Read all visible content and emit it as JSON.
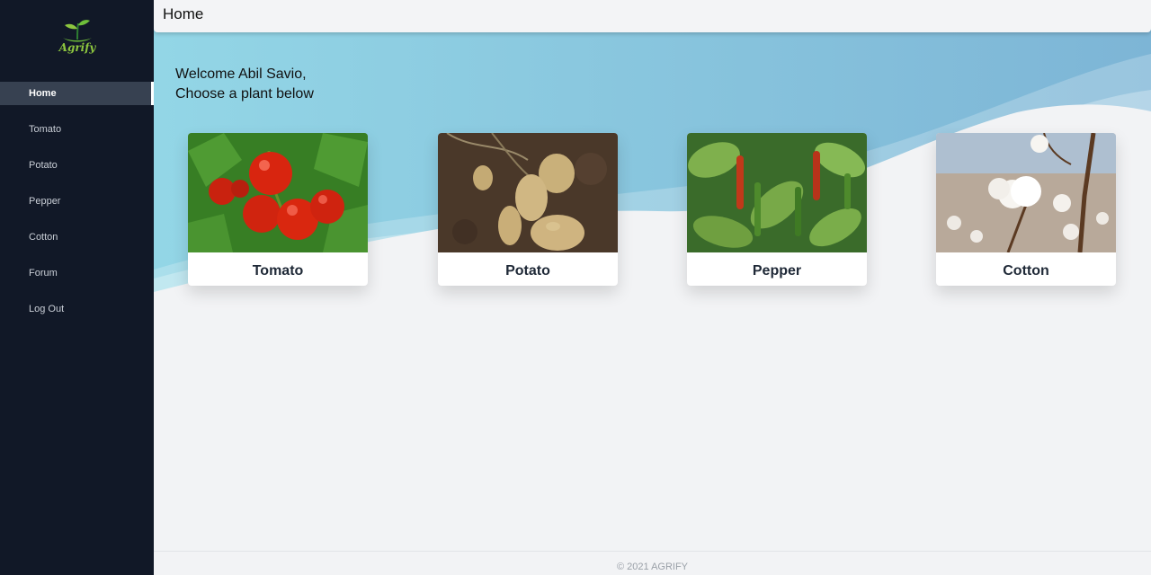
{
  "brand": {
    "name": "Agrify",
    "color": "#8dc63f"
  },
  "sidebar": {
    "items": [
      {
        "label": "Home",
        "active": true
      },
      {
        "label": "Tomato"
      },
      {
        "label": "Potato"
      },
      {
        "label": "Pepper"
      },
      {
        "label": "Cotton"
      },
      {
        "label": "Forum"
      },
      {
        "label": "Log Out"
      }
    ]
  },
  "header": {
    "title": "Home"
  },
  "welcome": {
    "line1": "Welcome Abil Savio,",
    "line2": "Choose a plant below"
  },
  "cards": [
    {
      "label": "Tomato"
    },
    {
      "label": "Potato"
    },
    {
      "label": "Pepper"
    },
    {
      "label": "Cotton"
    }
  ],
  "footer": {
    "text": "© 2021 AGRIFY"
  }
}
